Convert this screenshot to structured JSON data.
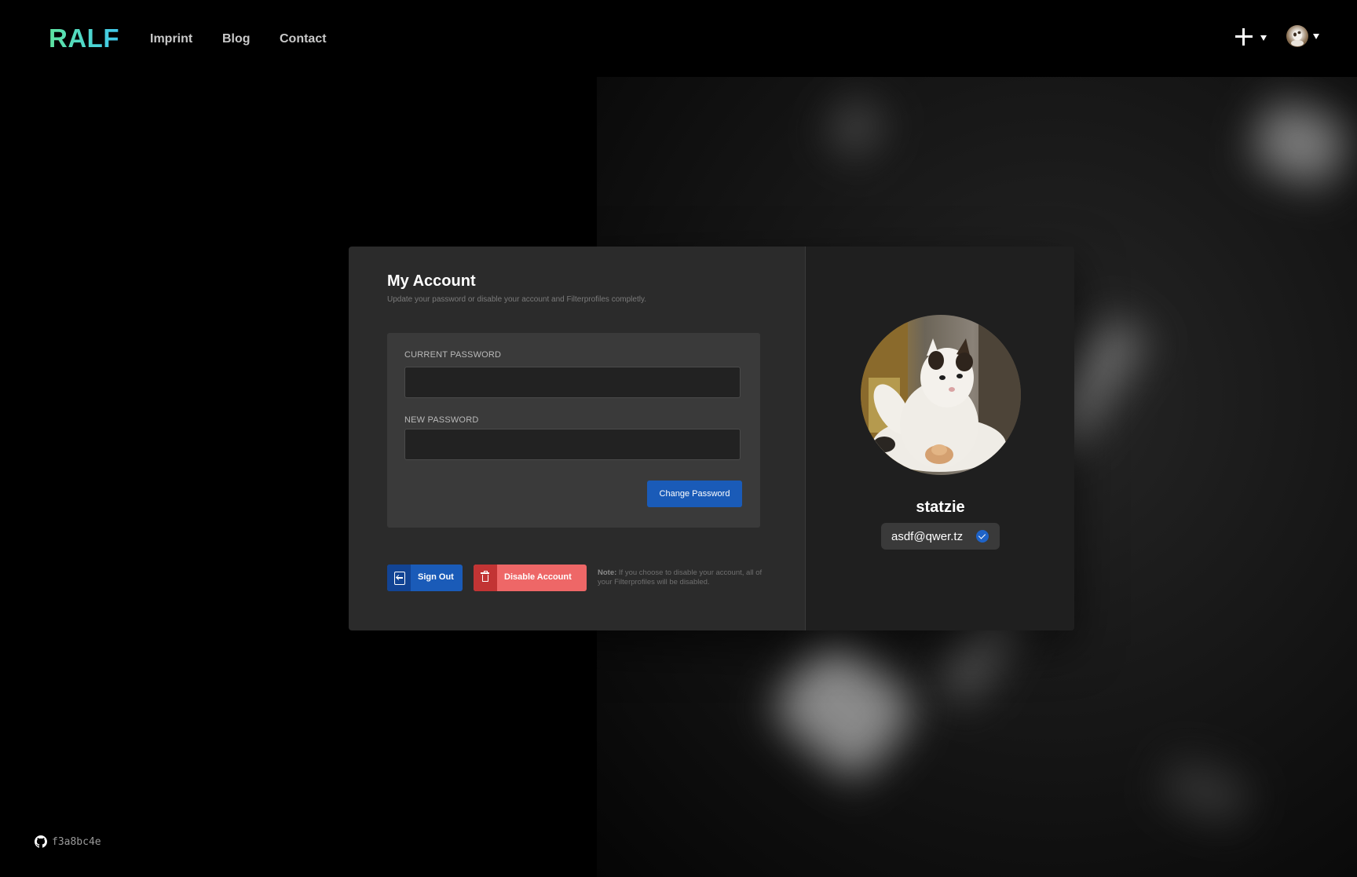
{
  "header": {
    "logo": "RALF",
    "nav": {
      "imprint": "Imprint",
      "blog": "Blog",
      "contact": "Contact"
    },
    "add_menu_icon": "plus-icon",
    "user_menu_icon": "avatar"
  },
  "account": {
    "title": "My Account",
    "subtitle": "Update your password or disable your account and Filterprofiles completly.",
    "current_password_label": "CURRENT PASSWORD",
    "current_password_value": "",
    "new_password_label": "NEW PASSWORD",
    "new_password_value": "",
    "change_password_button": "Change Password",
    "sign_out_button": "Sign Out",
    "disable_account_button": "Disable Account",
    "note_label": "Note:",
    "note_text": " If you choose to disable your account, all of your Filterprofiles will be disabled."
  },
  "profile": {
    "username": "statzie",
    "email": "asdf@qwer.tz",
    "email_verified": true
  },
  "footer": {
    "commit": "f3a8bc4e"
  },
  "colors": {
    "primary": "#1a5bb8",
    "danger": "#ee6767",
    "danger_dark": "#c23434",
    "logo_from": "#5ee3a0",
    "logo_to": "#3fc4e8"
  }
}
